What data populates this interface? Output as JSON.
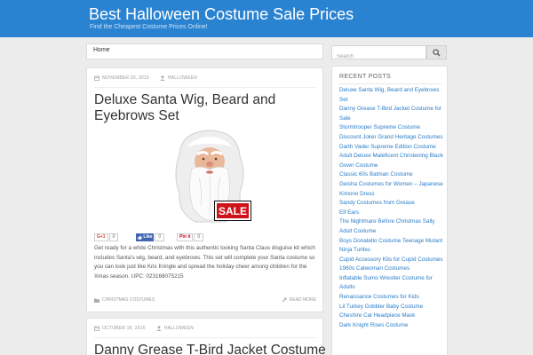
{
  "site": {
    "title": "Best Halloween Costume Sale Prices",
    "tagline": "Find the Cheapest Costume Prices Online!"
  },
  "nav": {
    "home_label": "Home"
  },
  "search": {
    "placeholder": "Search"
  },
  "posts": [
    {
      "date": "NOVEMBER 20, 2015",
      "author": "HALLOWEEN",
      "title_line1": "Deluxe Santa Wig, Beard and",
      "title_line2": "Eyebrows Set",
      "sale_label": "SALE",
      "share": {
        "gplus_label": "G+1",
        "gplus_count": "0",
        "like_label": "Like",
        "like_count": "0",
        "pin_label": "Pin it",
        "pin_count": "0"
      },
      "excerpt": "Get ready for a white Christmas with this authentic looking Santa Claus disguise kit which includes Santa's wig, beard, and eyebrows. This set will complete your Santa costume so you can look just like Kris Kringle and spread the holiday cheer among children for the Xmas season. UPC: 023168075215",
      "category": "CHRISTMAS COSTUMES",
      "read_more": "READ MORE"
    },
    {
      "date": "OCTOBER 18, 2015",
      "author": "HALLOWEEN",
      "title_line1": "Danny Grease T-Bird Jacket Costume"
    }
  ],
  "sidebar": {
    "heading": "RECENT POSTS",
    "items": [
      "Deluxe Santa Wig, Beard and Eyebrows Set",
      "Danny Grease T-Bird Jacket Costume for Sale",
      "Stormtrooper Supreme Costume",
      "Discount Joker Grand Heritage Costumes",
      "Darth Vader Supreme Edition Costume",
      "Adult Deluxe Maleficent Christening Black Gown Costume",
      "Classic 60s Batman Costume",
      "Geisha Costumes for Women – Japanese Kimono Dress",
      "Sandy Costumes from Grease",
      "Elf Ears",
      "The Nightmare Before Christmas Sally Adult Costume",
      "Boys Donatello Costume Teenage Mutant Ninja Turtles",
      "Cupid Accessory Kits for Cupid Costumes",
      "1960s Catwoman Costumes",
      "Inflatable Sumo Wrestler Costume for Adults",
      "Renaissance Costumes for Kids",
      "Lil Turkey Gobbler Baby Costume",
      "Cheshire Cat Headpiece Mask",
      "Dark Knight Rises Costume"
    ]
  },
  "colors": {
    "header_bg": "#2a83d1",
    "link": "#2a7cc7",
    "sale_red": "#d0131b"
  }
}
